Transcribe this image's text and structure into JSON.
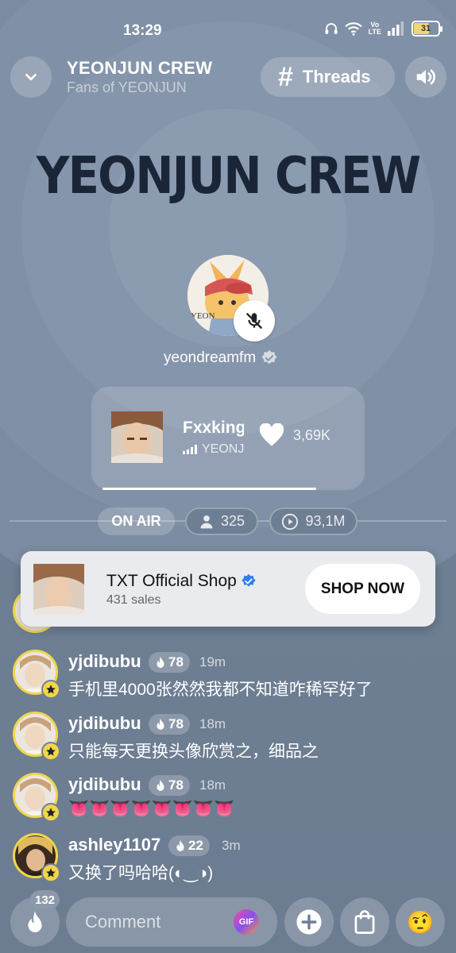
{
  "status_bar": {
    "time": "13:29",
    "battery": "31"
  },
  "header": {
    "title": "YEONJUN CREW",
    "subtitle": "Fans of YEONJUN",
    "threads_label": "Threads"
  },
  "banner_title": "YEONJUN CREW",
  "host": {
    "name": "yeondreamfm",
    "muted": true
  },
  "now_playing": {
    "title": "Fxxking",
    "artist": "YEONJUN",
    "likes": "3,69K",
    "progress_fraction": 0.79
  },
  "stats": {
    "status": "ON AIR",
    "listeners": "325",
    "plays": "93,1M"
  },
  "shop": {
    "name": "TXT Official Shop",
    "sales": "431 sales",
    "button": "SHOP NOW"
  },
  "messages": [
    {
      "user": "yjdibubu",
      "level": "78",
      "time": "19m",
      "text": "手机里4000张然然我都不知道咋稀罕好了"
    },
    {
      "user": "yjdibubu",
      "level": "78",
      "time": "18m",
      "text": "只能每天更换头像欣赏之，细品之"
    },
    {
      "user": "yjdibubu",
      "level": "78",
      "time": "18m",
      "text": "👅👅👅👅👅👅👅👅"
    },
    {
      "user": "ashley1107",
      "level": "22",
      "time": "3m",
      "text": "又换了吗哈哈(◐‿◑)"
    }
  ],
  "bottom_bar": {
    "fire_count": "132",
    "comment_placeholder": "Comment",
    "gif_label": "GIF",
    "emoji": "🤨"
  }
}
